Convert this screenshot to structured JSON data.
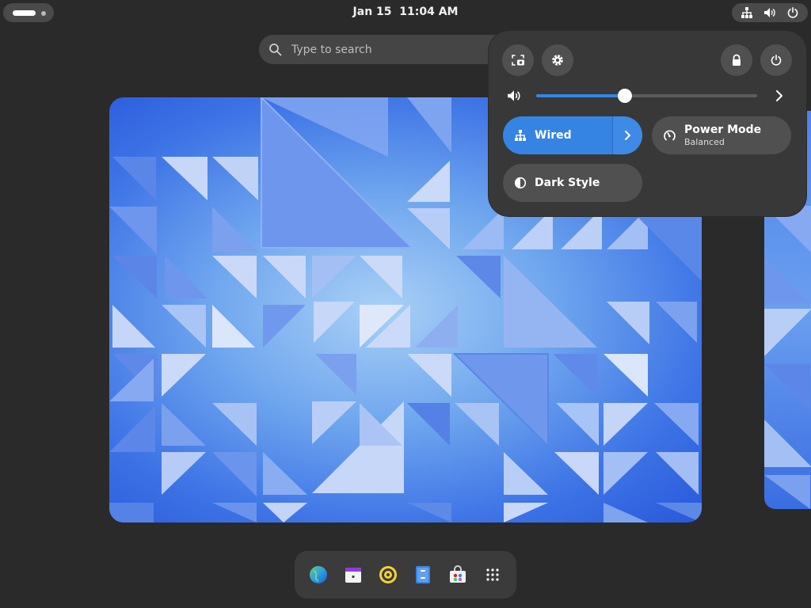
{
  "topbar": {
    "clock": "Jan 15  11:04 AM",
    "activities_icon": "workspace-indicator-icon",
    "status_icons": [
      "network-wired-icon",
      "speaker-volume-icon",
      "power-icon"
    ]
  },
  "search": {
    "placeholder": "Type to search",
    "value": "",
    "icon": "search-icon"
  },
  "quick_settings": {
    "top_buttons": [
      "screenshot-icon",
      "settings-gear-icon",
      "lock-icon",
      "power-off-icon"
    ],
    "volume": {
      "level": 0.4,
      "icon": "speaker-volume-icon",
      "more_icon": "chevron-right-icon"
    },
    "tiles": [
      {
        "label": "Wired",
        "subtitle": "",
        "active": true,
        "icon": "network-wired-icon",
        "has_arrow": true
      },
      {
        "label": "Power Mode",
        "subtitle": "Balanced",
        "active": false,
        "icon": "power-mode-icon",
        "has_arrow": false
      },
      {
        "label": "Dark Style",
        "subtitle": "",
        "active": false,
        "icon": "dark-style-icon",
        "has_arrow": false
      }
    ]
  },
  "dash": {
    "apps": [
      "web-browser-icon",
      "calendar-icon",
      "rhythmbox-icon",
      "files-icon",
      "software-store-icon",
      "app-grid-icon"
    ]
  },
  "colors": {
    "accent": "#3584e4",
    "background": "#2a2a2a",
    "panel": "#383838",
    "button": "#505050",
    "wallpaper_light": "#a9d0f6",
    "wallpaper_dark": "#2858db"
  }
}
